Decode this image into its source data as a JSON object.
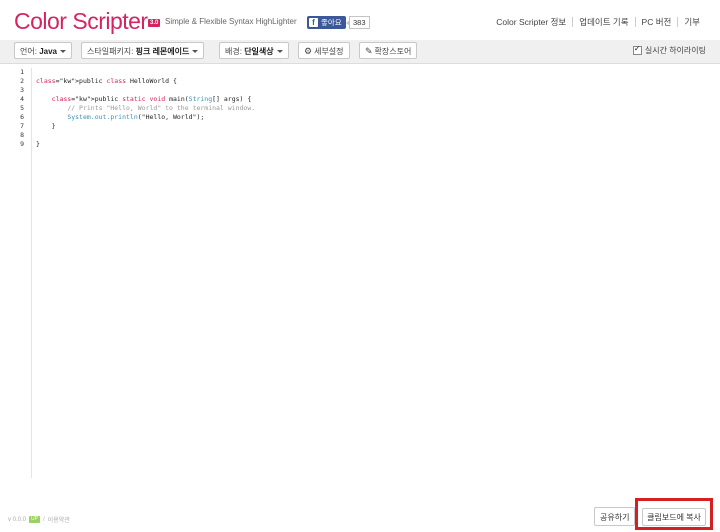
{
  "header": {
    "logo": "Color Scripter",
    "version_badge": "3.0",
    "tagline": "Simple & Flexible Syntax HighLighter",
    "facebook_like": "좋아요",
    "facebook_count": "383",
    "nav": [
      "Color Scripter 정보",
      "업데이트 기록",
      "PC 버전",
      "기부"
    ]
  },
  "toolbar": {
    "language_label": "언어:",
    "language_value": "Java",
    "style_label": "스타일패키지:",
    "style_value": "핑크 레몬에이드",
    "background_label": "배경:",
    "background_value": "단일색상",
    "settings_label": "세부설정",
    "extension_label": "확장스토어",
    "realtime_label": "실시간 하이라이팅",
    "realtime_checked": true
  },
  "editor": {
    "language": "Java",
    "line_numbers": [
      "1",
      "2",
      "3",
      "4",
      "5",
      "6",
      "7",
      "8",
      "9"
    ],
    "lines": [
      "",
      "public class HelloWorld {",
      "",
      "    public static void main(String[] args) {",
      "        // Prints \"Hello, World\" to the terminal window.",
      "        System.out.println(\"Hello, World\");",
      "    }",
      "",
      "}"
    ]
  },
  "footer": {
    "version": "v 0.0.0",
    "update_badge": "UP",
    "separator": "/",
    "terms": "이용약관",
    "share_label": "공유하기",
    "copy_label": "클립보드에 복사"
  },
  "colors": {
    "brand": "#d6245f",
    "comment": "#999999",
    "system": "#3a8fb7",
    "highlight_box": "#d42020"
  }
}
